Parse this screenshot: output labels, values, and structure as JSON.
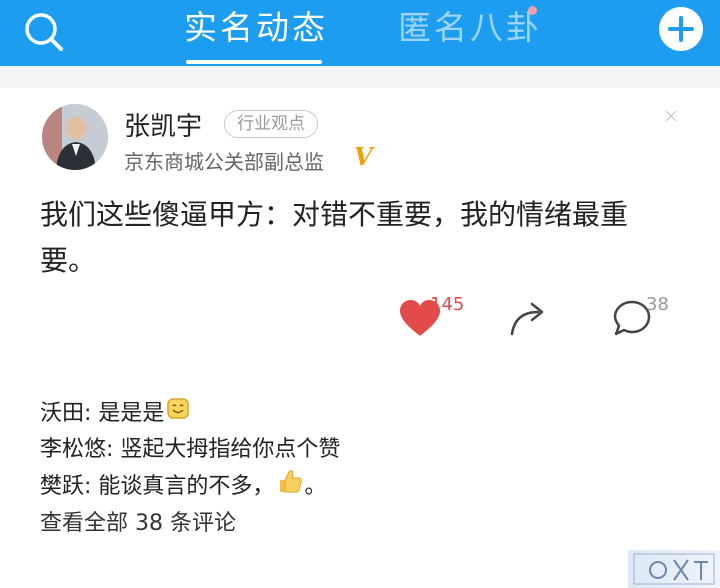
{
  "header": {
    "tabs": [
      {
        "label": "实名动态",
        "active": true
      },
      {
        "label": "匿名八卦",
        "active": false
      }
    ],
    "accent_color": "#1c9df0",
    "search_icon": "search-icon",
    "add_icon": "plus-icon"
  },
  "post": {
    "author": "张凯宇",
    "badge": "行业观点",
    "author_title": "京东商城公关部副总监",
    "verified_mark": "V",
    "content": "我们这些傻逼甲方：对错不重要，我的情绪最重要。",
    "likes": "145",
    "comments_count": "38",
    "like_color": "#e34a4a"
  },
  "comments": [
    {
      "name": "沃田",
      "text": "是是是",
      "emoji": "smile-emoji"
    },
    {
      "name": "李松悠",
      "text": "竖起大拇指给你点个赞"
    },
    {
      "name": "樊跃",
      "text": "能谈真言的不多，",
      "emoji": "thumbs-up-emoji",
      "suffix": "。"
    }
  ],
  "view_all": "查看全部 38 条评论"
}
